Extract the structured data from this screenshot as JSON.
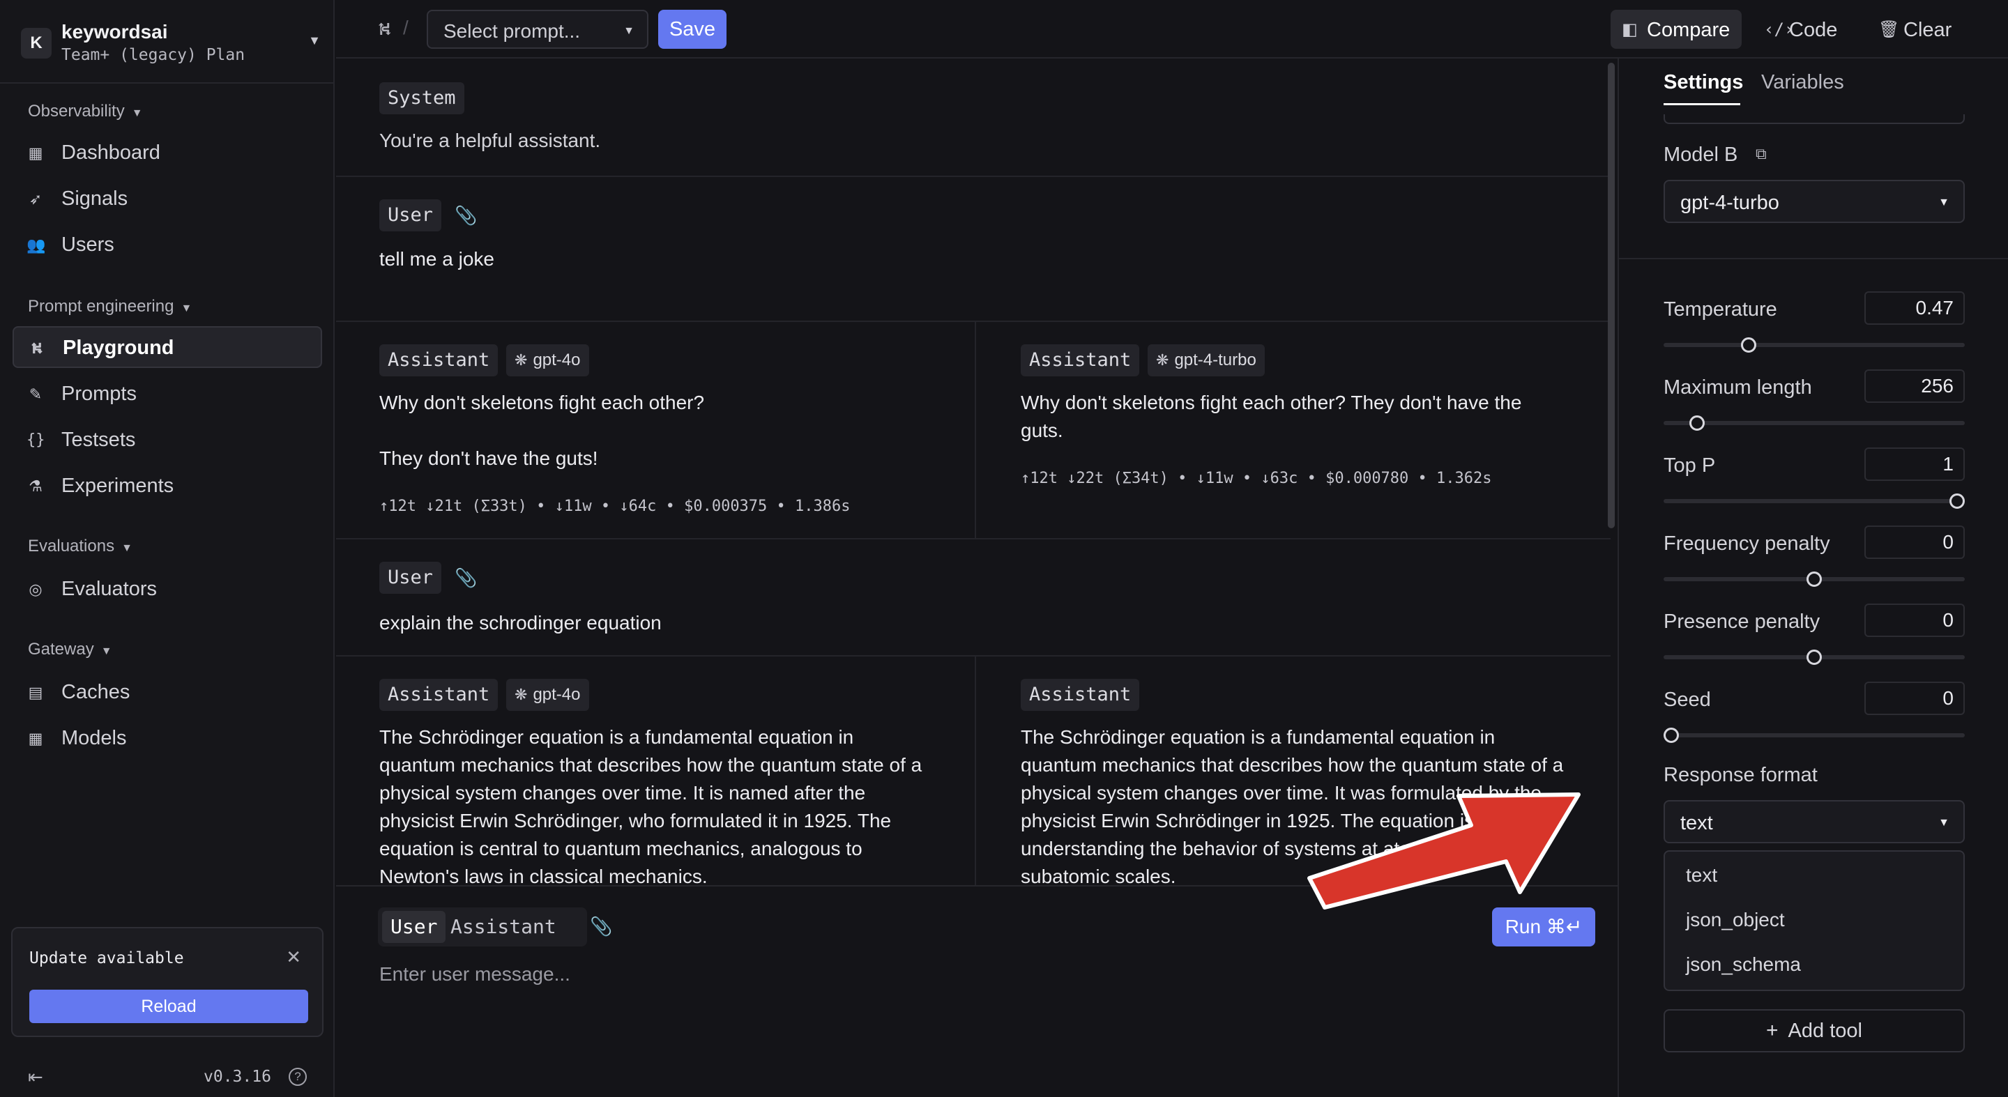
{
  "org": {
    "badge": "K",
    "name": "keywordsai",
    "plan": "Team+ (legacy) Plan"
  },
  "sidebar": {
    "sections": [
      {
        "title": "Observability",
        "items": [
          {
            "label": "Dashboard",
            "icon": "dashboard-icon"
          },
          {
            "label": "Signals",
            "icon": "telescope-icon"
          },
          {
            "label": "Users",
            "icon": "users-icon"
          }
        ]
      },
      {
        "title": "Prompt engineering",
        "items": [
          {
            "label": "Playground",
            "icon": "playground-icon",
            "active": true
          },
          {
            "label": "Prompts",
            "icon": "pencil-icon"
          },
          {
            "label": "Testsets",
            "icon": "braces-icon"
          },
          {
            "label": "Experiments",
            "icon": "flask-icon"
          }
        ]
      },
      {
        "title": "Evaluations",
        "items": [
          {
            "label": "Evaluators",
            "icon": "evaluator-icon"
          }
        ]
      },
      {
        "title": "Gateway",
        "items": [
          {
            "label": "Caches",
            "icon": "archive-icon"
          },
          {
            "label": "Models",
            "icon": "table-icon"
          }
        ]
      }
    ],
    "update": {
      "title": "Update available",
      "button": "Reload"
    },
    "version": "v0.3.16"
  },
  "topbar": {
    "prompt_placeholder": "Select prompt...",
    "save_label": "Save",
    "compare_label": "Compare",
    "code_label": "Code",
    "clear_label": "Clear"
  },
  "messages": {
    "system": {
      "role": "System",
      "content": "You're a helpful assistant."
    },
    "user1": {
      "role": "User",
      "content": "tell me a joke"
    },
    "assistant1": {
      "a": {
        "role": "Assistant",
        "model": "gpt-4o",
        "line1": "Why don't skeletons fight each other?",
        "line2": "They don't have the guts!",
        "meta": "↑12t ↓21t (Σ33t) • ↓11w • ↓64c • $0.000375 • 1.386s"
      },
      "b": {
        "role": "Assistant",
        "model": "gpt-4-turbo",
        "line1": "Why don't skeletons fight each other? They don't have the",
        "line2": "guts.",
        "meta": "↑12t ↓22t (Σ34t) • ↓11w • ↓63c • $0.000780 • 1.362s"
      }
    },
    "user2": {
      "role": "User",
      "content": "explain the schrodinger equation"
    },
    "assistant2": {
      "a": {
        "role": "Assistant",
        "model": "gpt-4o",
        "lines": [
          "The Schrödinger equation is a fundamental equation in",
          "quantum mechanics that describes how the quantum state of a",
          "physical system changes over time. It is named after the",
          "physicist Erwin Schrödinger, who formulated it in 1925. The",
          "equation is central to quantum mechanics, analogous to",
          "Newton's laws in classical mechanics."
        ]
      },
      "b": {
        "role": "Assistant",
        "lines": [
          "The Schrödinger equation is a fundamental equation in",
          "quantum mechanics that describes how the quantum state of a",
          "physical system changes over time. It was formulated by the",
          "physicist Erwin Schrödinger in 1925. The equation is key to",
          "understanding the behavior of systems at atomic and",
          "subatomic scales."
        ]
      }
    }
  },
  "composer": {
    "role_user": "User",
    "role_assistant": "Assistant",
    "placeholder": "Enter user message...",
    "run_label": "Run ⌘↵"
  },
  "panel": {
    "tabs": [
      "Settings",
      "Variables"
    ],
    "model_b_label": "Model B",
    "model_b_value": "gpt-4-turbo",
    "params": [
      {
        "label": "Temperature",
        "value": "0.47",
        "fraction": 0.27
      },
      {
        "label": "Maximum length",
        "value": "256",
        "fraction": 0.09
      },
      {
        "label": "Top P",
        "value": "1",
        "fraction": 1.0
      },
      {
        "label": "Frequency penalty",
        "value": "0",
        "fraction": 0.5
      },
      {
        "label": "Presence penalty",
        "value": "0",
        "fraction": 0.5
      },
      {
        "label": "Seed",
        "value": "0",
        "fraction": 0.0
      }
    ],
    "response_format_label": "Response format",
    "response_format_value": "text",
    "response_format_options": [
      "text",
      "json_object",
      "json_schema"
    ],
    "add_tool_label": "Add tool"
  },
  "colors": {
    "accent": "#6478f0",
    "annotation_arrow": "#d8352a"
  }
}
